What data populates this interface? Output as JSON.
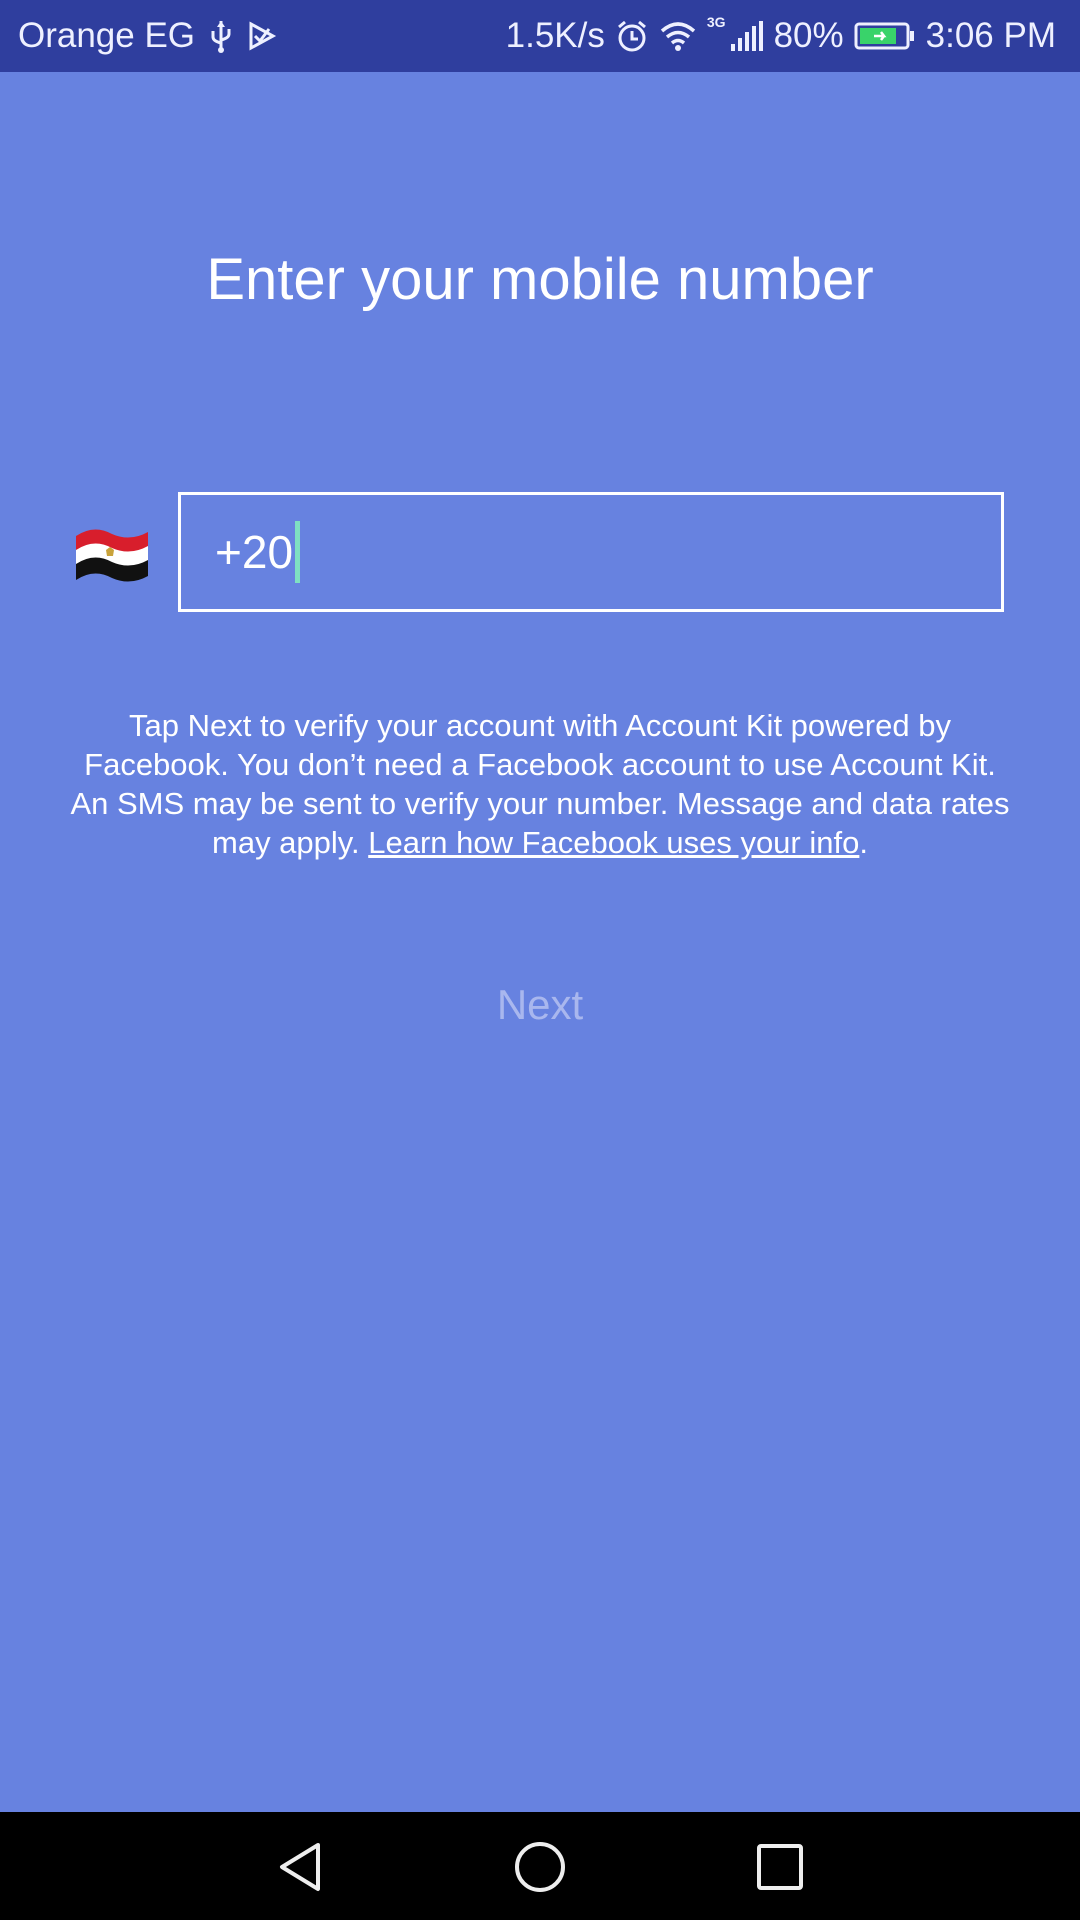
{
  "status_bar": {
    "carrier": "Orange EG",
    "speed": "1.5K/s",
    "network": "3G",
    "battery": "80%",
    "time": "3:06 PM"
  },
  "screen": {
    "title": "Enter your mobile number",
    "country_flag": "egypt-flag",
    "phone_value": "+20",
    "info_text": "Tap Next to verify your account with Account Kit powered by Facebook. You don’t need a Facebook account to use Account Kit. An SMS may be sent to verify your number. Message and data rates may apply. ",
    "info_link": "Learn how Facebook uses your info",
    "info_end": ".",
    "next_label": "Next"
  },
  "colors": {
    "background": "#6782e0",
    "status_bar": "#2f3e9e",
    "next_disabled": "#a9b7ee",
    "cursor": "#7fe0c2"
  },
  "icons": [
    "usb-icon",
    "play-icon",
    "alarm-icon",
    "wifi-icon",
    "signal-icon",
    "battery-icon",
    "back-icon",
    "home-icon",
    "recents-icon"
  ]
}
